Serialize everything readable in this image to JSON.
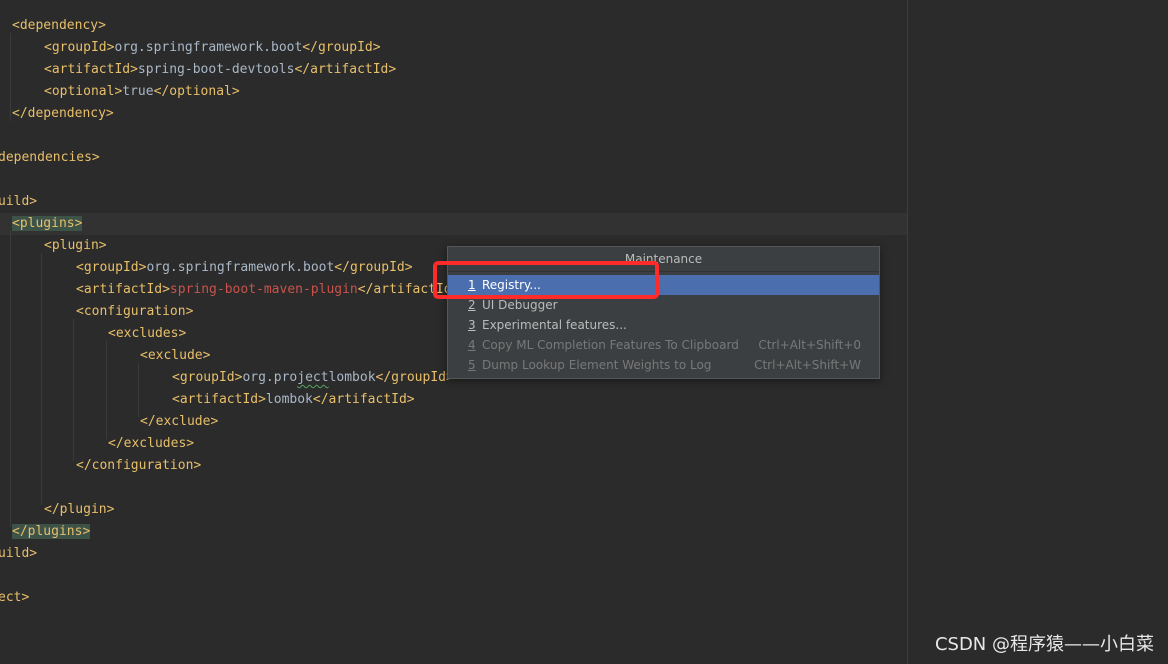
{
  "code_lines": [
    {
      "indent": "  ",
      "parts": [
        [
          "tag",
          "<dependency>"
        ]
      ]
    },
    {
      "indent": "      ",
      "parts": [
        [
          "tag",
          "<groupId>"
        ],
        [
          "txt",
          "org.springframework.boot"
        ],
        [
          "tag",
          "</groupId>"
        ]
      ]
    },
    {
      "indent": "      ",
      "parts": [
        [
          "tag",
          "<artifactId>"
        ],
        [
          "txt",
          "spring-boot-devtools"
        ],
        [
          "tag",
          "</artifactId>"
        ]
      ]
    },
    {
      "indent": "      ",
      "parts": [
        [
          "tag",
          "<optional>"
        ],
        [
          "txt",
          "true"
        ],
        [
          "tag",
          "</optional>"
        ]
      ]
    },
    {
      "indent": "  ",
      "parts": [
        [
          "tag",
          "</dependency>"
        ]
      ]
    },
    {
      "indent": "",
      "parts": []
    },
    {
      "indent": "",
      "parts": [
        [
          "tag",
          "dependencies>"
        ]
      ]
    },
    {
      "indent": "",
      "parts": []
    },
    {
      "indent": "",
      "parts": [
        [
          "tag",
          "uild>"
        ]
      ]
    },
    {
      "indent": "  ",
      "parts": [
        [
          "tag-hl",
          "<plugins>"
        ]
      ]
    },
    {
      "indent": "      ",
      "parts": [
        [
          "tag",
          "<plugin>"
        ]
      ]
    },
    {
      "indent": "          ",
      "parts": [
        [
          "tag",
          "<groupId>"
        ],
        [
          "txt",
          "org.springframework.boot"
        ],
        [
          "tag",
          "</groupId>"
        ]
      ]
    },
    {
      "indent": "          ",
      "parts": [
        [
          "tag",
          "<artifactId>"
        ],
        [
          "red",
          "spring-boot-maven-plugin"
        ],
        [
          "tag",
          "</artifactId>"
        ]
      ]
    },
    {
      "indent": "          ",
      "parts": [
        [
          "tag",
          "<configuration>"
        ]
      ]
    },
    {
      "indent": "              ",
      "parts": [
        [
          "tag",
          "<excludes>"
        ]
      ]
    },
    {
      "indent": "                  ",
      "parts": [
        [
          "tag",
          "<exclude>"
        ]
      ]
    },
    {
      "indent": "                      ",
      "parts": [
        [
          "tag",
          "<groupId>"
        ],
        [
          "txt",
          "org.pro"
        ],
        [
          "typo",
          "ject"
        ],
        [
          "txt",
          "lombok"
        ],
        [
          "tag",
          "</groupId>"
        ]
      ]
    },
    {
      "indent": "                      ",
      "parts": [
        [
          "tag",
          "<artifactId>"
        ],
        [
          "txt",
          "lombok"
        ],
        [
          "tag",
          "</artifactId>"
        ]
      ]
    },
    {
      "indent": "                  ",
      "parts": [
        [
          "tag",
          "</exclude>"
        ]
      ]
    },
    {
      "indent": "              ",
      "parts": [
        [
          "tag",
          "</excludes>"
        ]
      ]
    },
    {
      "indent": "          ",
      "parts": [
        [
          "tag",
          "</configuration>"
        ]
      ]
    },
    {
      "indent": "",
      "parts": []
    },
    {
      "indent": "      ",
      "parts": [
        [
          "tag",
          "</plugin>"
        ]
      ]
    },
    {
      "indent": "  ",
      "parts": [
        [
          "tag-hl",
          "</plugins>"
        ]
      ]
    },
    {
      "indent": "",
      "parts": [
        [
          "tag",
          "uild>"
        ]
      ]
    },
    {
      "indent": "",
      "parts": []
    },
    {
      "indent": "",
      "parts": [
        [
          "tag",
          "ect>"
        ]
      ]
    }
  ],
  "popup": {
    "title": "Maintenance",
    "items": [
      {
        "num": "1",
        "label": "Registry...",
        "shortcut": "",
        "state": "selected"
      },
      {
        "num": "2",
        "label": "UI Debugger",
        "shortcut": "",
        "state": "normal"
      },
      {
        "num": "3",
        "label": "Experimental features...",
        "shortcut": "",
        "state": "normal"
      },
      {
        "num": "4",
        "label": "Copy ML Completion Features To Clipboard",
        "shortcut": "Ctrl+Alt+Shift+0",
        "state": "disabled"
      },
      {
        "num": "5",
        "label": "Dump Lookup Element Weights to Log",
        "shortcut": "Ctrl+Alt+Shift+W",
        "state": "disabled"
      }
    ]
  },
  "watermark": "CSDN @程序猿——小白菜",
  "colors": {
    "background": "#2b2b2b",
    "tag": "#e8bf6a",
    "text": "#a9b7c6",
    "error": "#c9524a",
    "selection": "#4b6eaf",
    "highlight_box": "#ff2a2a"
  }
}
